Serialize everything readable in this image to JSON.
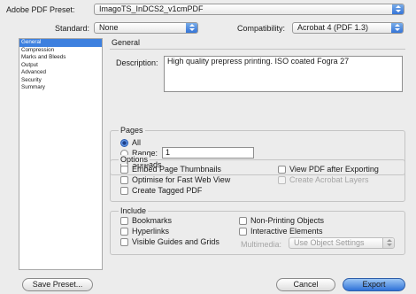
{
  "header": {
    "preset_label": "Adobe PDF Preset:",
    "preset_value": "ImagoTS_InDCS2_v1cmPDF",
    "standard_label": "Standard:",
    "standard_value": "None",
    "compat_label": "Compatibility:",
    "compat_value": "Acrobat 4 (PDF 1.3)"
  },
  "sidebar": {
    "items": [
      {
        "label": "General",
        "selected": true
      },
      {
        "label": "Compression"
      },
      {
        "label": "Marks and Bleeds"
      },
      {
        "label": "Output"
      },
      {
        "label": "Advanced"
      },
      {
        "label": "Security"
      },
      {
        "label": "Summary"
      }
    ]
  },
  "panel": {
    "title": "General",
    "description_label": "Description:",
    "description_value": "High quality prepress printing.  ISO coated Fogra 27"
  },
  "pages": {
    "title": "Pages",
    "all_label": "All",
    "range_label": "Range:",
    "range_value": "1",
    "spreads_label": "Spreads"
  },
  "options": {
    "title": "Options",
    "embed_thumbs": "Embed Page Thumbnails",
    "optimise_web": "Optimise for Fast Web View",
    "tagged_pdf": "Create Tagged PDF",
    "view_after": "View PDF after Exporting",
    "acrobat_layers": "Create Acrobat Layers"
  },
  "include": {
    "title": "Include",
    "bookmarks": "Bookmarks",
    "hyperlinks": "Hyperlinks",
    "guides_grids": "Visible Guides and Grids",
    "non_printing": "Non-Printing Objects",
    "interactive": "Interactive Elements",
    "multimedia_label": "Multimedia:",
    "multimedia_value": "Use Object Settings"
  },
  "footer": {
    "save_preset": "Save Preset...",
    "cancel": "Cancel",
    "export": "Export"
  },
  "colors": {
    "accent": "#3d80df",
    "background": "#ececec"
  }
}
